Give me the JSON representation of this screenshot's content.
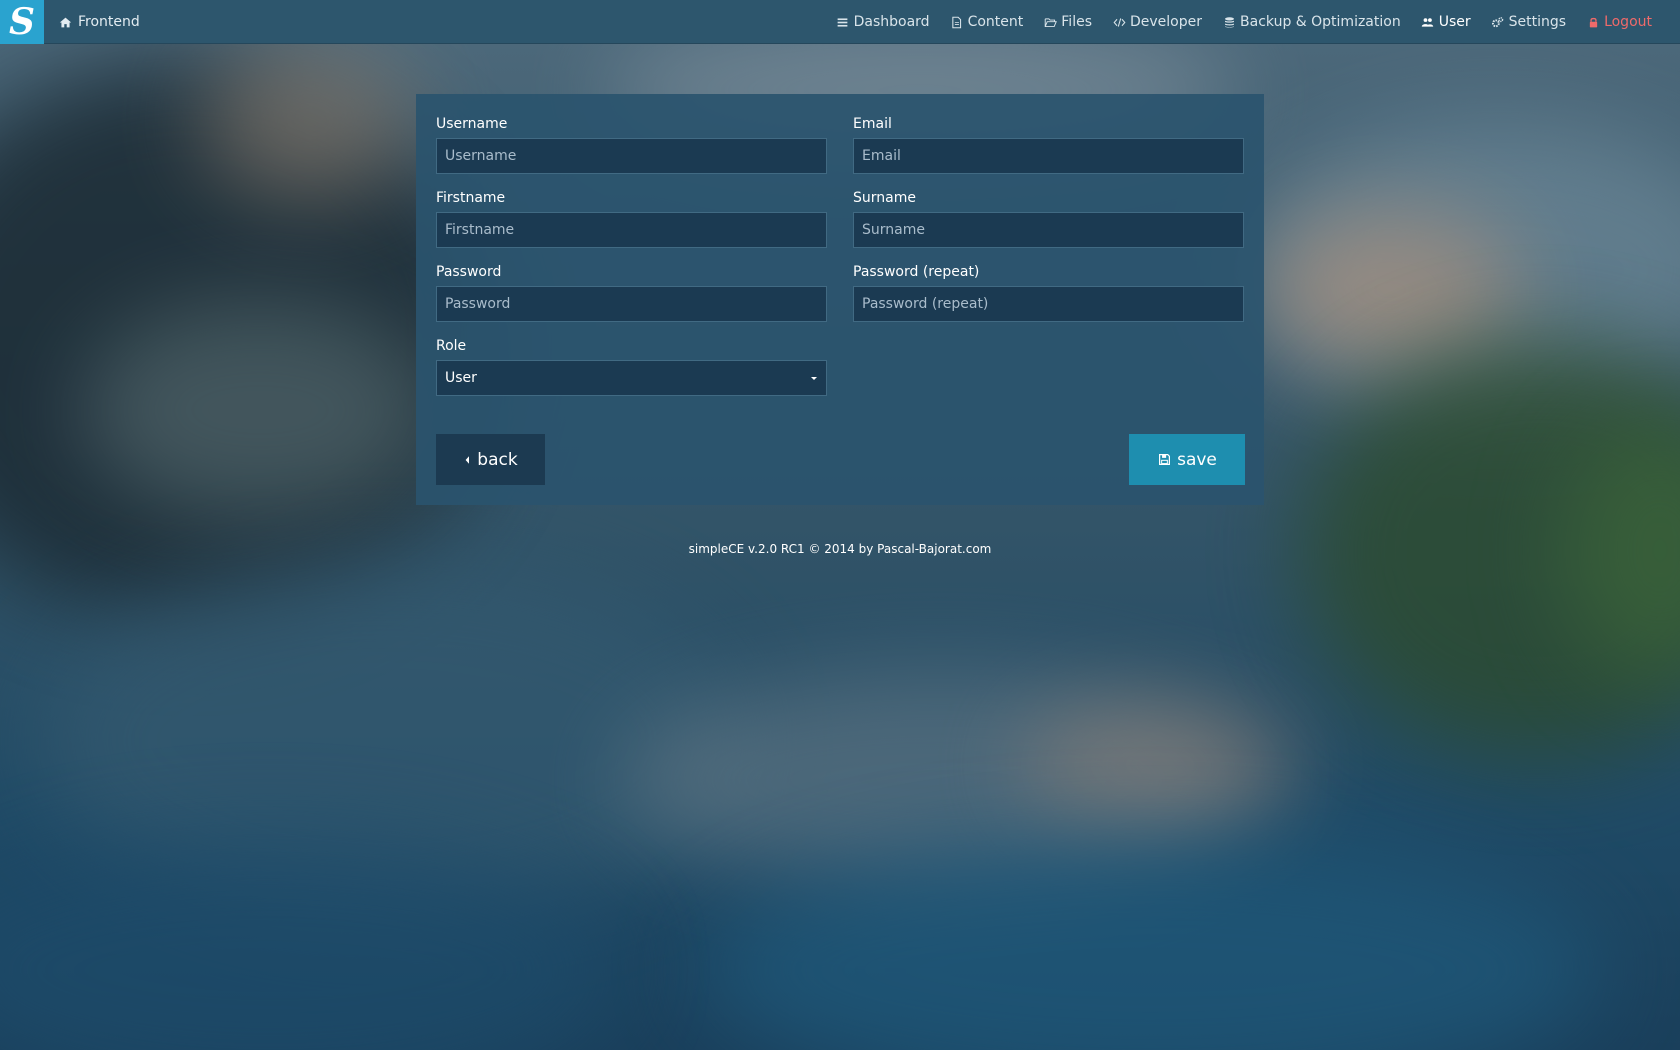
{
  "navbar": {
    "brand_letter": "S",
    "frontend_label": "Frontend",
    "items": [
      {
        "label": "Dashboard",
        "icon": "bars-icon"
      },
      {
        "label": "Content",
        "icon": "file-icon"
      },
      {
        "label": "Files",
        "icon": "folder-open-icon"
      },
      {
        "label": "Developer",
        "icon": "code-icon"
      },
      {
        "label": "Backup & Optimization",
        "icon": "database-icon"
      },
      {
        "label": "User",
        "icon": "users-icon",
        "active": true
      },
      {
        "label": "Settings",
        "icon": "gears-icon"
      },
      {
        "label": "Logout",
        "icon": "lock-icon",
        "color": "#ef6a6a"
      }
    ]
  },
  "form": {
    "username": {
      "label": "Username",
      "placeholder": "Username",
      "value": ""
    },
    "email": {
      "label": "Email",
      "placeholder": "Email",
      "value": ""
    },
    "firstname": {
      "label": "Firstname",
      "placeholder": "Firstname",
      "value": ""
    },
    "surname": {
      "label": "Surname",
      "placeholder": "Surname",
      "value": ""
    },
    "password": {
      "label": "Password",
      "placeholder": "Password",
      "value": ""
    },
    "password_repeat": {
      "label": "Password (repeat)",
      "placeholder": "Password (repeat)",
      "value": ""
    },
    "role": {
      "label": "Role",
      "selected": "User"
    },
    "back_label": "back",
    "save_label": "save"
  },
  "footer": {
    "text": "simpleCE v.2.0 RC1 © 2014 by Pascal-Bajorat.com"
  },
  "colors": {
    "navbar_bg": "#2d566d",
    "brand_bg": "#2aa3cf",
    "panel_bg": "#2a546e",
    "save_button": "#1e8eaf",
    "back_button": "#1c3a51",
    "logout": "#ef6a6a"
  }
}
